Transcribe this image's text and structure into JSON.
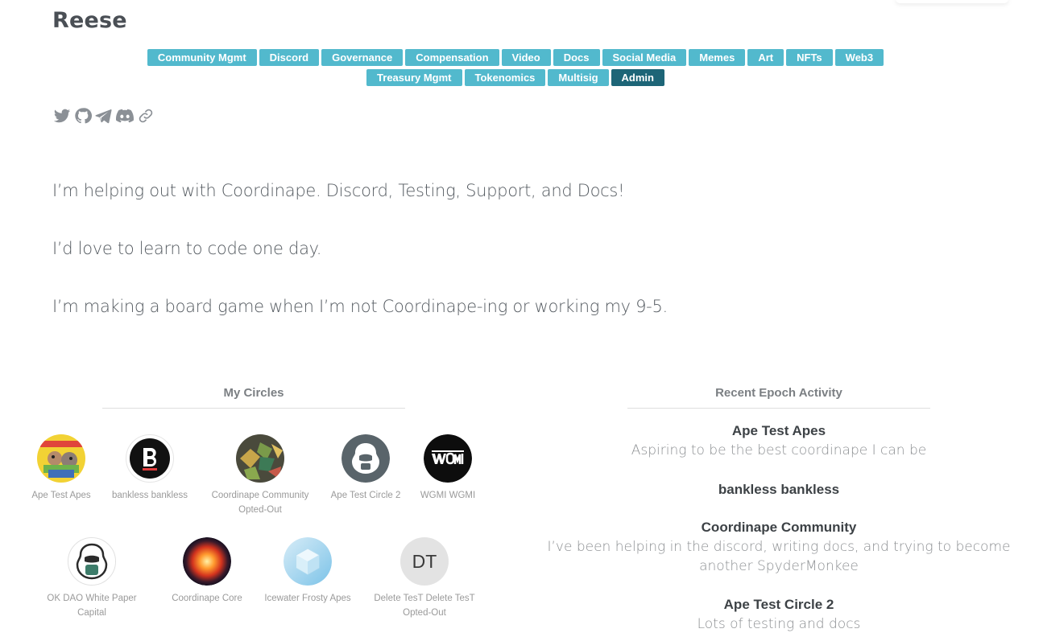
{
  "profile": {
    "name": "Reese",
    "skills": [
      {
        "label": "Community Mgmt",
        "selected": false
      },
      {
        "label": "Discord",
        "selected": false
      },
      {
        "label": "Governance",
        "selected": false
      },
      {
        "label": "Compensation",
        "selected": false
      },
      {
        "label": "Video",
        "selected": false
      },
      {
        "label": "Docs",
        "selected": false
      },
      {
        "label": "Social Media",
        "selected": false
      },
      {
        "label": "Memes",
        "selected": false
      },
      {
        "label": "Art",
        "selected": false
      },
      {
        "label": "NFTs",
        "selected": false
      },
      {
        "label": "Web3",
        "selected": false
      },
      {
        "label": "Treasury Mgmt",
        "selected": false
      },
      {
        "label": "Tokenomics",
        "selected": false
      },
      {
        "label": "Multisig",
        "selected": false
      },
      {
        "label": "Admin",
        "selected": true
      }
    ],
    "socials": [
      "twitter-icon",
      "github-icon",
      "telegram-icon",
      "discord-icon",
      "link-icon"
    ],
    "bio": [
      "I’m helping out with Coordinape.  Discord, Testing, Support, and Docs!",
      "I’d love to learn to code one day.",
      "I’m making a board game when I’m not Coordinape-ing or working my 9-5."
    ]
  },
  "my_circles": {
    "title": "My Circles",
    "items": [
      {
        "label": "Ape Test Apes",
        "sublabel": "",
        "avatar": "ape-test-apes-image"
      },
      {
        "label": "bankless bankless",
        "sublabel": "",
        "avatar": "bankless-logo"
      },
      {
        "label": "Coordinape Community",
        "sublabel": "Opted-Out",
        "avatar": "coordinape-community-image"
      },
      {
        "label": "Ape Test Circle 2",
        "sublabel": "",
        "avatar": "gorilla-logo"
      },
      {
        "label": "WGMI WGMI",
        "sublabel": "",
        "avatar": "wgmi-logo"
      },
      {
        "label": "OK DAO White Paper Capital",
        "sublabel": "",
        "avatar": "gorilla-outline-logo"
      },
      {
        "label": "Coordinape Core",
        "sublabel": "",
        "avatar": "orange-orb-image"
      },
      {
        "label": "Icewater Frosty Apes",
        "sublabel": "",
        "avatar": "ice-cube-image"
      },
      {
        "label": "Delete TesT Delete TesT",
        "sublabel": "Opted-Out",
        "avatar_initials": "DT"
      }
    ]
  },
  "recent_activity": {
    "title": "Recent Epoch Activity",
    "items": [
      {
        "circle": "Ape Test Apes",
        "text": "Aspiring to be the best coordinape I can be"
      },
      {
        "circle": "bankless bankless",
        "text": ""
      },
      {
        "circle": "Coordinape Community",
        "text": "I’ve been helping in the discord, writing docs, and trying to become another SpyderMonkee"
      },
      {
        "circle": "Ape Test Circle 2",
        "text": "Lots of testing and docs"
      }
    ]
  },
  "colors": {
    "tag": "#52b9cd",
    "tag_selected": "#1d6577",
    "icon": "#8b9096",
    "heading": "#4a4f55"
  }
}
